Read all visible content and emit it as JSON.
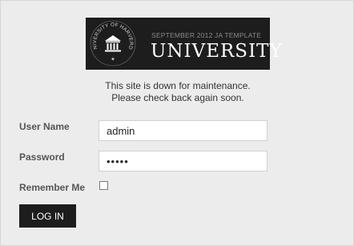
{
  "logo": {
    "seal_text": "UNIVERSITY OF HARVERDE",
    "subtitle": "SEPTEMBER 2012 JA TEMPLATE",
    "title": "UNIVERSITY",
    "icon": "building-columns-icon"
  },
  "notice": {
    "line1": "This site is down for maintenance.",
    "line2": "Please check back again soon."
  },
  "form": {
    "username_label": "User Name",
    "username_value": "admin",
    "password_label": "Password",
    "password_value": "•••••",
    "remember_label": "Remember Me",
    "remember_checked": false,
    "login_label": "LOG IN"
  },
  "colors": {
    "background": "#ececec",
    "logo_bg": "#1d1d1d",
    "button_bg": "#1d1d1d"
  }
}
